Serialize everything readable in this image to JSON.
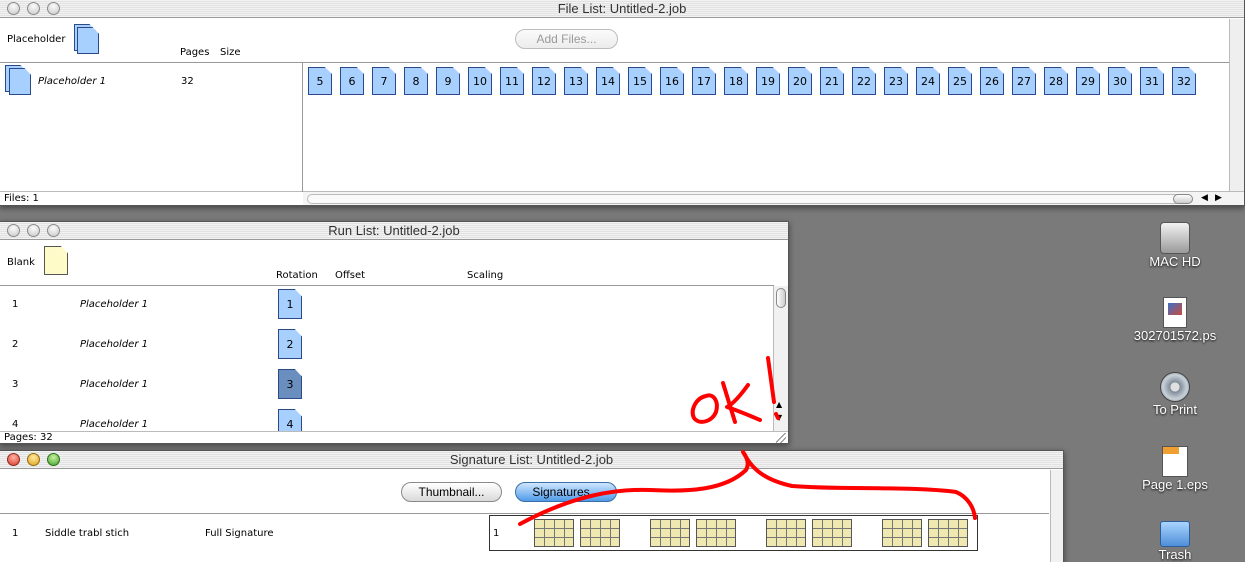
{
  "file_list": {
    "title": "File List: Untitled-2.job",
    "placeholder_label": "Placeholder",
    "col_pages": "Pages",
    "col_size": "Size",
    "add_files_label": "Add Files...",
    "row": {
      "name": "Placeholder 1",
      "pages": "32"
    },
    "page_tiles": [
      "5",
      "6",
      "7",
      "8",
      "9",
      "10",
      "11",
      "12",
      "13",
      "14",
      "15",
      "16",
      "17",
      "18",
      "19",
      "20",
      "21",
      "22",
      "23",
      "24",
      "25",
      "26",
      "27",
      "28",
      "29",
      "30",
      "31",
      "32"
    ],
    "status": "Files: 1"
  },
  "run_list": {
    "title": "Run List: Untitled-2.job",
    "blank_label": "Blank",
    "col_rotation": "Rotation",
    "col_offset": "Offset",
    "col_scaling": "Scaling",
    "rows": [
      {
        "num": "1",
        "name": "Placeholder 1",
        "page": "1"
      },
      {
        "num": "2",
        "name": "Placeholder 1",
        "page": "2"
      },
      {
        "num": "3",
        "name": "Placeholder 1",
        "page": "3"
      },
      {
        "num": "4",
        "name": "Placeholder 1",
        "page": "4"
      }
    ],
    "status": "Pages: 32"
  },
  "signature_list": {
    "title": "Signature List: Untitled-2.job",
    "thumbnail_label": "Thumbnail...",
    "signatures_label": "Signatures...",
    "row": {
      "num": "1",
      "name": "Siddle trabl stich",
      "type": "Full Signature",
      "index": "1"
    }
  },
  "annotation": {
    "text": "OK!",
    "color": "#ff0000"
  },
  "desktop_icons": [
    {
      "label": "MAC HD",
      "icon": "hard-drive-icon"
    },
    {
      "label": "302701572.ps",
      "icon": "postscript-file-icon"
    },
    {
      "label": "To Print",
      "icon": "disk-icon"
    },
    {
      "label": "Page 1.eps",
      "icon": "eps-file-icon"
    },
    {
      "label": "Trash",
      "icon": "folder-icon"
    }
  ]
}
